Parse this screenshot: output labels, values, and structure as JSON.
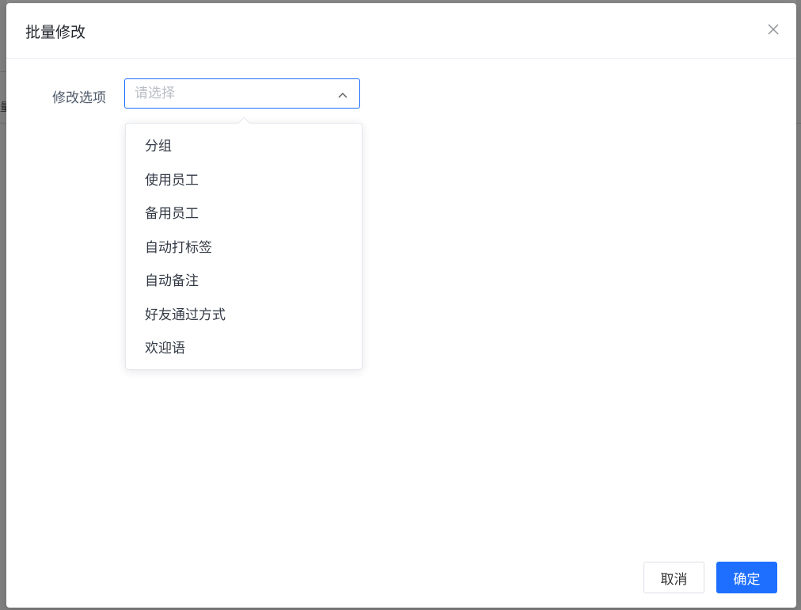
{
  "dialog": {
    "title": "批量修改",
    "close_icon": "close-icon"
  },
  "form": {
    "label": "修改选项",
    "select": {
      "placeholder": "请选择",
      "value": "",
      "icon": "chevron-up-icon",
      "accent_color": "#1e6fff"
    }
  },
  "dropdown": {
    "options": [
      "分组",
      "使用员工",
      "备用员工",
      "自动打标签",
      "自动备注",
      "好友通过方式",
      "欢迎语"
    ]
  },
  "footer": {
    "cancel_label": "取消",
    "confirm_label": "确定",
    "primary_color": "#1e6fff"
  },
  "background": {
    "left_fragment": "量"
  }
}
